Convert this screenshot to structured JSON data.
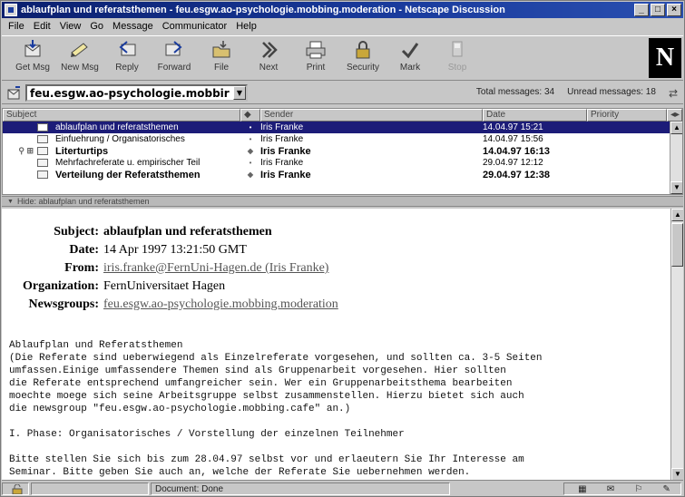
{
  "window": {
    "title": "ablaufplan und referatsthemen - feu.esgw.ao-psychologie.mobbing.moderation - Netscape Discussion"
  },
  "menu": [
    "File",
    "Edit",
    "View",
    "Go",
    "Message",
    "Communicator",
    "Help"
  ],
  "toolbar": {
    "buttons": [
      {
        "label": "Get Msg",
        "icon": "get-msg-icon"
      },
      {
        "label": "New Msg",
        "icon": "new-msg-icon"
      },
      {
        "label": "Reply",
        "icon": "reply-icon"
      },
      {
        "label": "Forward",
        "icon": "forward-icon"
      },
      {
        "label": "File",
        "icon": "file-icon"
      },
      {
        "label": "Next",
        "icon": "next-icon"
      },
      {
        "label": "Print",
        "icon": "print-icon"
      },
      {
        "label": "Security",
        "icon": "security-icon"
      },
      {
        "label": "Mark",
        "icon": "mark-icon"
      },
      {
        "label": "Stop",
        "icon": "stop-icon"
      }
    ],
    "logo": "N"
  },
  "location": {
    "newsgroup": "feu.esgw.ao-psychologie.mobbir",
    "total_label": "Total messages: 34",
    "unread_label": "Unread messages: 18"
  },
  "list": {
    "columns": {
      "subject": "Subject",
      "sender": "Sender",
      "date": "Date",
      "priority": "Priority"
    },
    "rows": [
      {
        "subject": "ablaufplan und referatsthemen",
        "sender": "Iris Franke",
        "date": "14.04.97 15:21"
      },
      {
        "subject": "Einfuehrung / Organisatorisches",
        "sender": "Iris Franke",
        "date": "14.04.97 15:56"
      },
      {
        "subject": "Literturtips",
        "sender": "Iris Franke",
        "date": "14.04.97 16:13"
      },
      {
        "subject": "Mehrfachreferate u. empirischer Teil",
        "sender": "Iris Franke",
        "date": "29.04.97 12:12"
      },
      {
        "subject": "Verteilung der Referatsthemen",
        "sender": "Iris Franke",
        "date": "29.04.97 12:38"
      }
    ]
  },
  "hidebar": {
    "label": "Hide: ablaufplan und referatsthemen"
  },
  "message": {
    "labels": {
      "subject": "Subject:",
      "date": "Date:",
      "from": "From:",
      "organization": "Organization:",
      "newsgroups": "Newsgroups:"
    },
    "subject": "ablaufplan und referatsthemen",
    "date": "14 Apr 1997 13:21:50 GMT",
    "from": "iris.franke@FernUni-Hagen.de (Iris Franke)",
    "organization": "FernUniversitaet Hagen",
    "newsgroups": "feu.esgw.ao-psychologie.mobbing.moderation",
    "body_lines": [
      "Ablaufplan und Referatsthemen",
      "(Die Referate sind ueberwiegend als Einzelreferate vorgesehen, und sollten ca. 3-5 Seiten",
      "umfassen.Einige umfassendere Themen sind als Gruppenarbeit vorgesehen. Hier sollten",
      "die Referate entsprechend umfangreicher sein. Wer ein Gruppenarbeitsthema bearbeiten",
      "moechte moege sich seine Arbeitsgruppe selbst zusammenstellen. Hierzu bietet sich auch",
      "die newsgroup \"feu.esgw.ao-psychologie.mobbing.cafe\" an.)",
      "",
      "I. Phase: Organisatorisches / Vorstellung der einzelnen Teilnehmer",
      "",
      "Bitte stellen Sie sich bis zum 28.04.97 selbst vor und erlaeutern Sie Ihr Interesse am",
      "Seminar. Bitte geben Sie auch an, welche der Referate Sie uebernehmen werden."
    ]
  },
  "status": {
    "text": "Document: Done"
  }
}
